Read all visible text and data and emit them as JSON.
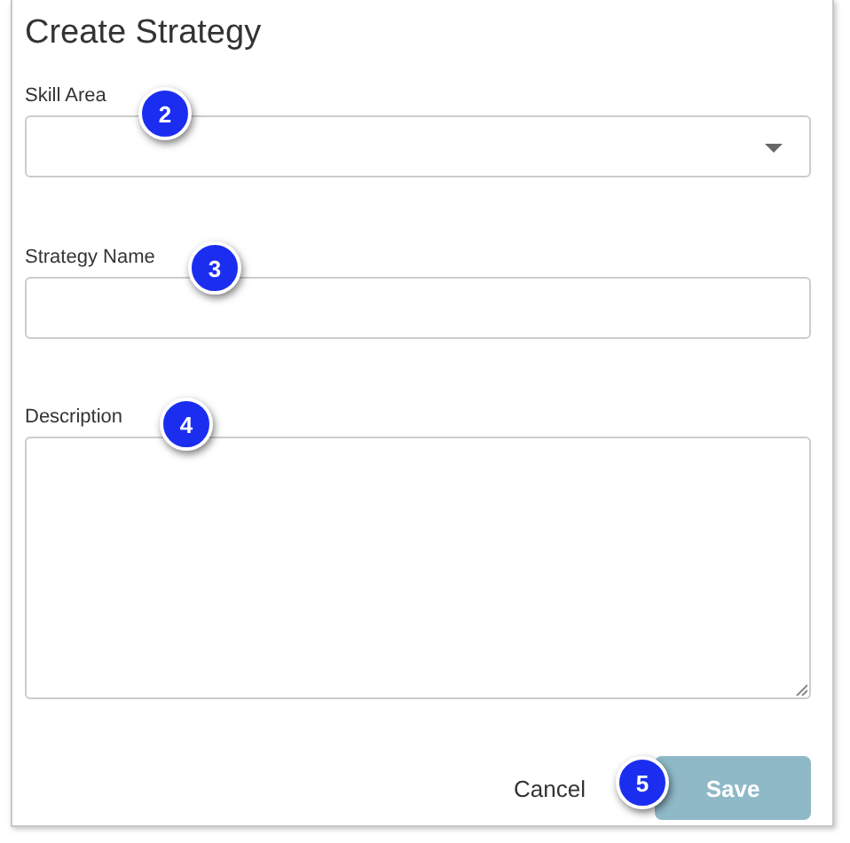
{
  "dialog": {
    "title": "Create Strategy"
  },
  "fields": [
    {
      "kind": "select",
      "label": "Skill Area"
    },
    {
      "kind": "text",
      "label": "Strategy Name"
    },
    {
      "kind": "textarea",
      "label": "Description"
    }
  ],
  "buttons": [
    {
      "kind": "link",
      "label": "Cancel"
    },
    {
      "kind": "primary",
      "label": "Save",
      "disabled": true
    }
  ],
  "callouts": [
    {
      "label": "2"
    },
    {
      "label": "3"
    },
    {
      "label": "4"
    },
    {
      "label": "5"
    }
  ]
}
